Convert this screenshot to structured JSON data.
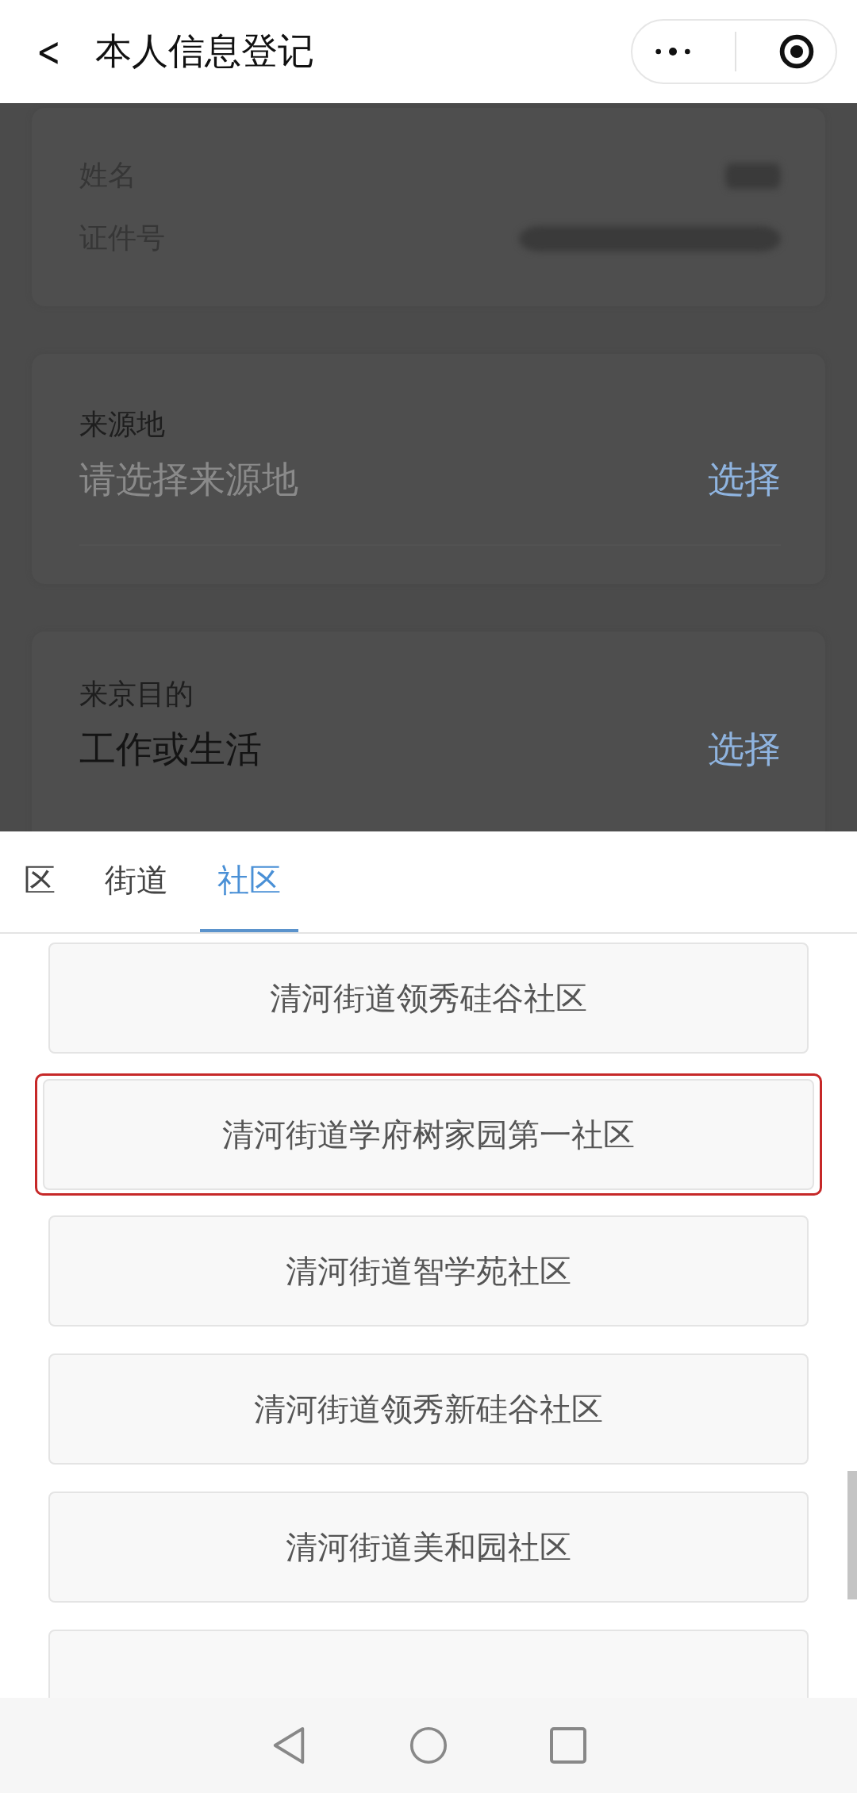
{
  "header": {
    "back": "<",
    "title": "本人信息登记"
  },
  "identity_card": {
    "fields": [
      {
        "label": "姓名"
      },
      {
        "label": "证件号"
      }
    ]
  },
  "origin": {
    "label": "来源地",
    "placeholder": "请选择来源地",
    "action": "选择"
  },
  "purpose": {
    "label": "来京目的",
    "value": "工作或生活",
    "action": "选择"
  },
  "picker": {
    "tabs": [
      {
        "label": "区",
        "selected": false
      },
      {
        "label": "街道",
        "selected": false
      },
      {
        "label": "社区",
        "selected": true
      }
    ],
    "options": [
      {
        "label": "清河街道领秀硅谷社区",
        "selected": false
      },
      {
        "label": "清河街道学府树家园第一社区",
        "selected": true
      },
      {
        "label": "清河街道智学苑社区",
        "selected": false
      },
      {
        "label": "清河街道领秀新硅谷社区",
        "selected": false
      },
      {
        "label": "清河街道美和园社区",
        "selected": false
      }
    ]
  }
}
